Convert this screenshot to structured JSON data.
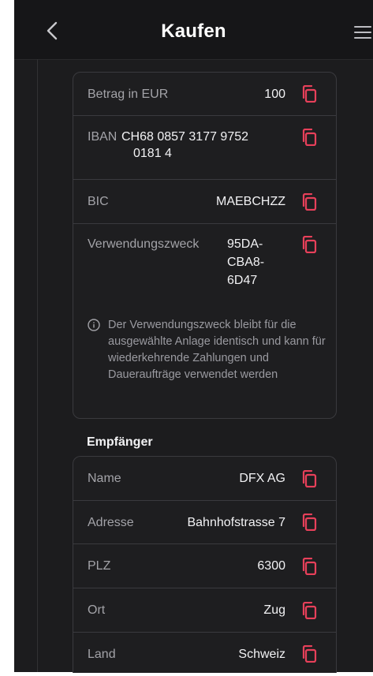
{
  "header": {
    "title": "Kaufen",
    "back_icon": "chevron-left-icon",
    "menu_icon": "hamburger-icon"
  },
  "payment": {
    "amount_label": "Betrag in EUR",
    "amount_value": "100",
    "iban_label": "IBAN",
    "iban_line1": "CH68 0857 3177 9752",
    "iban_line2": "0181 4",
    "bic_label": "BIC",
    "bic_value": "MAEBCHZZ",
    "reference_label": "Verwendungszweck",
    "reference_line1": "95DA-",
    "reference_line2": "CBA8-",
    "reference_line3": "6D47",
    "info_text": "Der Verwendungszweck bleibt für die ausgewählte Anlage identisch und kann für wiederkehrende Zahlungen und Daueraufträge verwendet werden"
  },
  "recipient": {
    "section_title": "Empfänger",
    "name_label": "Name",
    "name_value": "DFX AG",
    "address_label": "Adresse",
    "address_value": "Bahnhofstrasse 7",
    "zip_label": "PLZ",
    "zip_value": "6300",
    "city_label": "Ort",
    "city_value": "Zug",
    "country_label": "Land",
    "country_value": "Schweiz"
  },
  "colors": {
    "accent": "#e8405a",
    "background": "#1c1c1e",
    "card_border": "#3a3a3e"
  }
}
